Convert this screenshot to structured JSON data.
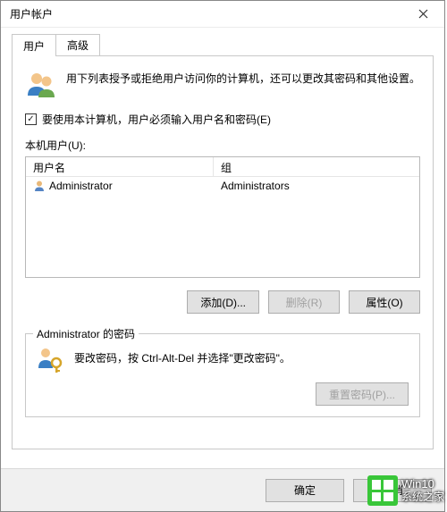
{
  "window": {
    "title": "用户帐户"
  },
  "tabs": {
    "users": "用户",
    "advanced": "高级"
  },
  "intro": "用下列表授予或拒绝用户访问你的计算机，还可以更改其密码和其他设置。",
  "checkbox": {
    "checked": "✓",
    "label": "要使用本计算机，用户必须输入用户名和密码(E)"
  },
  "localUsersLabel": "本机用户(U):",
  "listHeader": {
    "name": "用户名",
    "group": "组"
  },
  "rows": [
    {
      "name": "Administrator",
      "group": "Administrators"
    }
  ],
  "buttons": {
    "add": "添加(D)...",
    "remove": "删除(R)",
    "props": "属性(O)"
  },
  "passwordBox": {
    "legend": "Administrator 的密码",
    "text": "要改密码，按 Ctrl-Alt-Del 并选择\"更改密码\"。",
    "reset": "重置密码(P)..."
  },
  "dialog": {
    "ok": "确定",
    "cancel": "取消"
  },
  "watermark": {
    "line1": "Win10",
    "line2": "系统之家"
  }
}
